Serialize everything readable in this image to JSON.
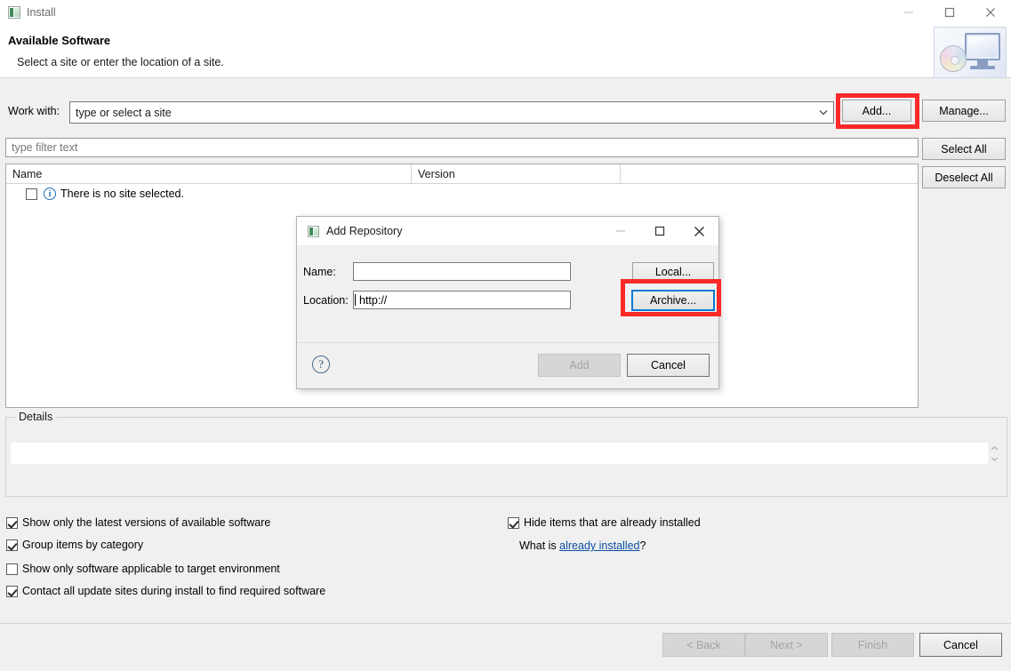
{
  "window": {
    "title": "Install",
    "icon": "eclipse-install-icon",
    "controls": {
      "minimize": "minimize-icon",
      "maximize": "maximize-icon",
      "close": "close-icon"
    }
  },
  "header": {
    "title": "Available Software",
    "subtitle": "Select a site or enter the location of a site.",
    "banner_icon": "monitor-disc-icon"
  },
  "work_with": {
    "label": "Work with:",
    "value": "",
    "placeholder": "type or select a site",
    "dropdown_icon": "chevron-down-icon"
  },
  "buttons": {
    "add": "Add...",
    "manage": "Manage...",
    "select_all": "Select All",
    "deselect_all": "Deselect All"
  },
  "filter": {
    "value": "",
    "placeholder": "type filter text"
  },
  "table": {
    "columns": [
      "Name",
      "Version"
    ],
    "rows": [
      {
        "checked": false,
        "icon": "info-icon",
        "name": "There is no site selected.",
        "version": ""
      }
    ]
  },
  "details": {
    "legend": "Details",
    "value": "",
    "spinner_up_icon": "caret-up-icon",
    "spinner_down_icon": "caret-down-icon"
  },
  "options": {
    "left": [
      {
        "label": "Show only the latest versions of available software",
        "checked": true
      },
      {
        "label": "Group items by category",
        "checked": true
      },
      {
        "label": "Show only software applicable to target environment",
        "checked": false
      },
      {
        "label": "Contact all update sites during install to find required software",
        "checked": true
      }
    ],
    "right": [
      {
        "label": "Hide items that are already installed",
        "checked": true
      }
    ],
    "what_is_prefix": "What is ",
    "what_is_link": "already installed",
    "what_is_suffix": "?"
  },
  "footer": {
    "help_icon": "help-icon",
    "back": "< Back",
    "next": "Next >",
    "finish": "Finish",
    "cancel": "Cancel",
    "back_enabled": false,
    "next_enabled": false,
    "finish_enabled": false,
    "cancel_enabled": true
  },
  "modal": {
    "title": "Add Repository",
    "icon": "eclipse-install-icon",
    "controls": {
      "minimize": "minimize-icon",
      "maximize": "maximize-icon",
      "close": "close-icon"
    },
    "name_label": "Name:",
    "name_value": "",
    "location_label": "Location:",
    "location_value": "http://",
    "local_button": "Local...",
    "archive_button": "Archive...",
    "archive_focused": true,
    "help_icon": "help-icon",
    "add_button": "Add",
    "add_enabled": false,
    "cancel_button": "Cancel"
  },
  "annotations": {
    "highlight_color": "#fb2929",
    "focus_color": "#0a7ad4",
    "targets": [
      "add-button",
      "archive-button"
    ]
  }
}
